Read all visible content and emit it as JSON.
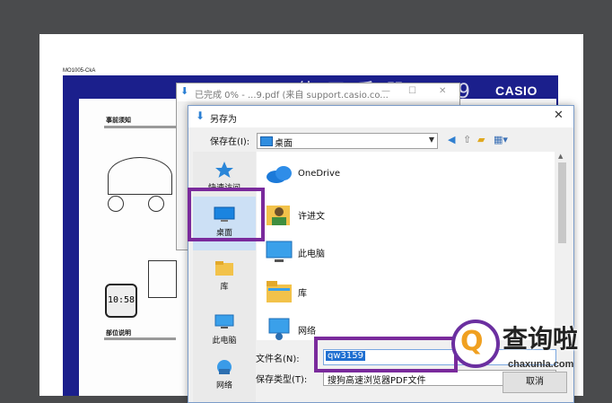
{
  "pdf": {
    "model_code": "MO1005-CkA",
    "title": "使 用 手 册  3159",
    "brand": "CASIO",
    "sections": [
      "事前须知",
      "部位说明"
    ],
    "lcd_time": "10:58"
  },
  "download_window": {
    "title": "已完成 0% - ...9.pdf (来自 support.casio.co...",
    "min": "—",
    "max": "☐",
    "close": "✕"
  },
  "dialog": {
    "title": "另存为",
    "close": "✕",
    "save_in_label": "保存在(I):",
    "save_in_value": "桌面",
    "places": [
      {
        "label": "快速访问",
        "icon": "quick-access-icon"
      },
      {
        "label": "桌面",
        "icon": "desktop-icon"
      },
      {
        "label": "库",
        "icon": "library-icon"
      },
      {
        "label": "此电脑",
        "icon": "this-pc-icon"
      },
      {
        "label": "网络",
        "icon": "network-icon"
      }
    ],
    "files": [
      {
        "label": "OneDrive",
        "icon": "onedrive-icon"
      },
      {
        "label": "许进文",
        "icon": "user-folder-icon"
      },
      {
        "label": "此电脑",
        "icon": "this-pc-icon"
      },
      {
        "label": "库",
        "icon": "library-icon"
      },
      {
        "label": "网络",
        "icon": "network-icon"
      }
    ],
    "filename_label": "文件名(N):",
    "filename_value": "qw3159",
    "filetype_label": "保存类型(T):",
    "filetype_value": "搜狗高速浏览器PDF文件",
    "cancel_label": "取消",
    "accent_color": "#7a2a9c"
  },
  "watermark": {
    "logo_letter": "Q",
    "text": "查询啦",
    "url": "chaxunla.com"
  }
}
